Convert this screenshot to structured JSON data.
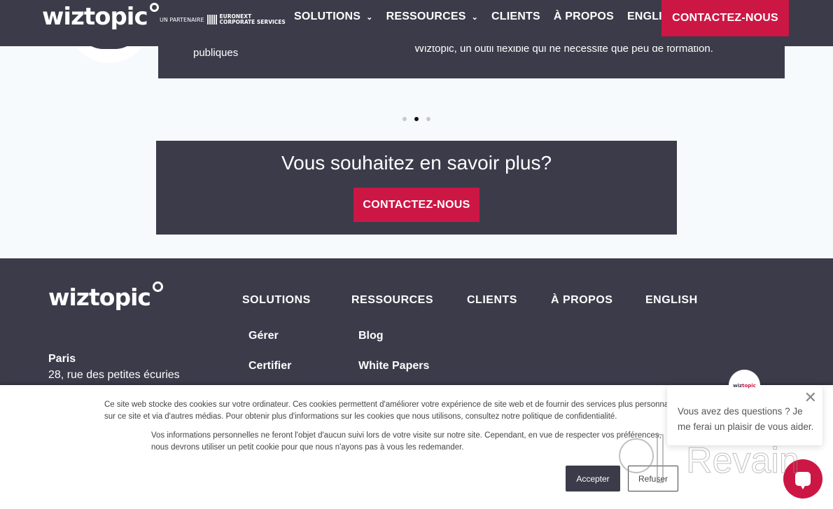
{
  "header": {
    "logo": "wiztopic",
    "partner_prefix": "UN PARTENAIRE",
    "partner_line1": "EURONEXT",
    "partner_line2": "CORPORATE SERVICES",
    "nav": [
      {
        "label": "SOLUTIONS",
        "dropdown": true
      },
      {
        "label": "RESSOURCES",
        "dropdown": true
      },
      {
        "label": "CLIENTS",
        "dropdown": false
      },
      {
        "label": "À PROPOS",
        "dropdown": false
      },
      {
        "label": "ENGLISH",
        "dropdown": false
      }
    ],
    "chevron": "⌄",
    "cta": "CONTACTEZ-NOUS"
  },
  "carousel": {
    "left_text": "publiques",
    "right_text": "Wiztopic, un outil flexible qui ne nécessite que peu de formation.",
    "active_index": 1,
    "total": 3
  },
  "cta_band": {
    "title": "Vous souhaitez en savoir plus?",
    "button": "CONTACTEZ-NOUS"
  },
  "footer": {
    "logo": "wiztopic",
    "columns": [
      {
        "heading": "SOLUTIONS",
        "links": [
          "Gérer",
          "Certifier"
        ]
      },
      {
        "heading": "RESSOURCES",
        "links": [
          "Blog",
          "White Papers"
        ]
      },
      {
        "heading": "CLIENTS",
        "links": []
      },
      {
        "heading": "À PROPOS",
        "links": []
      },
      {
        "heading": "ENGLISH",
        "links": []
      }
    ],
    "city": "Paris",
    "address": "28, rue des petites écuries"
  },
  "cookie": {
    "paragraph1": "Ce site web stocke des cookies sur votre ordinateur. Ces cookies permettent d'améliorer votre expérience de site web et de fournir des services plus personnalisés, à la fois sur ce site et via d'autres médias. Pour obtenir plus d'informations sur les cookies que nous utilisons, consultez notre politique de confidentialité.",
    "p1_line1": "Ce site web stocke des cookies sur votre ordinateur. Ces cookies permettent d'améliorer votre expérience de site web et de fournir des services plus personnalisés, à la fois",
    "p1_line2": "sur ce site et via d'autres médias. Pour obtenir plus d'informations sur les cookies que nous utilisons, consultez notre politique de confidentialité.",
    "p2_line1": "Vos informations personnelles ne feront l'objet d'aucun suivi lors de votre visite sur notre site. Cependant, en vue de respecter vos préférences,",
    "p2_line2": "nous devrons utiliser un petit cookie pour que nous n'ayons pas à vous les redemander.",
    "accept": "Accepter",
    "refuse": "Refuser"
  },
  "chat": {
    "avatar_w": "wiz",
    "avatar_t": "topic",
    "message": "Vous avez des questions ? Je me ferai un plaisir de vous aider.",
    "close_icon": "✕"
  },
  "watermark": {
    "text": "Revain"
  },
  "colors": {
    "dark": "#3c3b4a",
    "accent": "#cc1745",
    "page_bg": "#f7fafd"
  }
}
